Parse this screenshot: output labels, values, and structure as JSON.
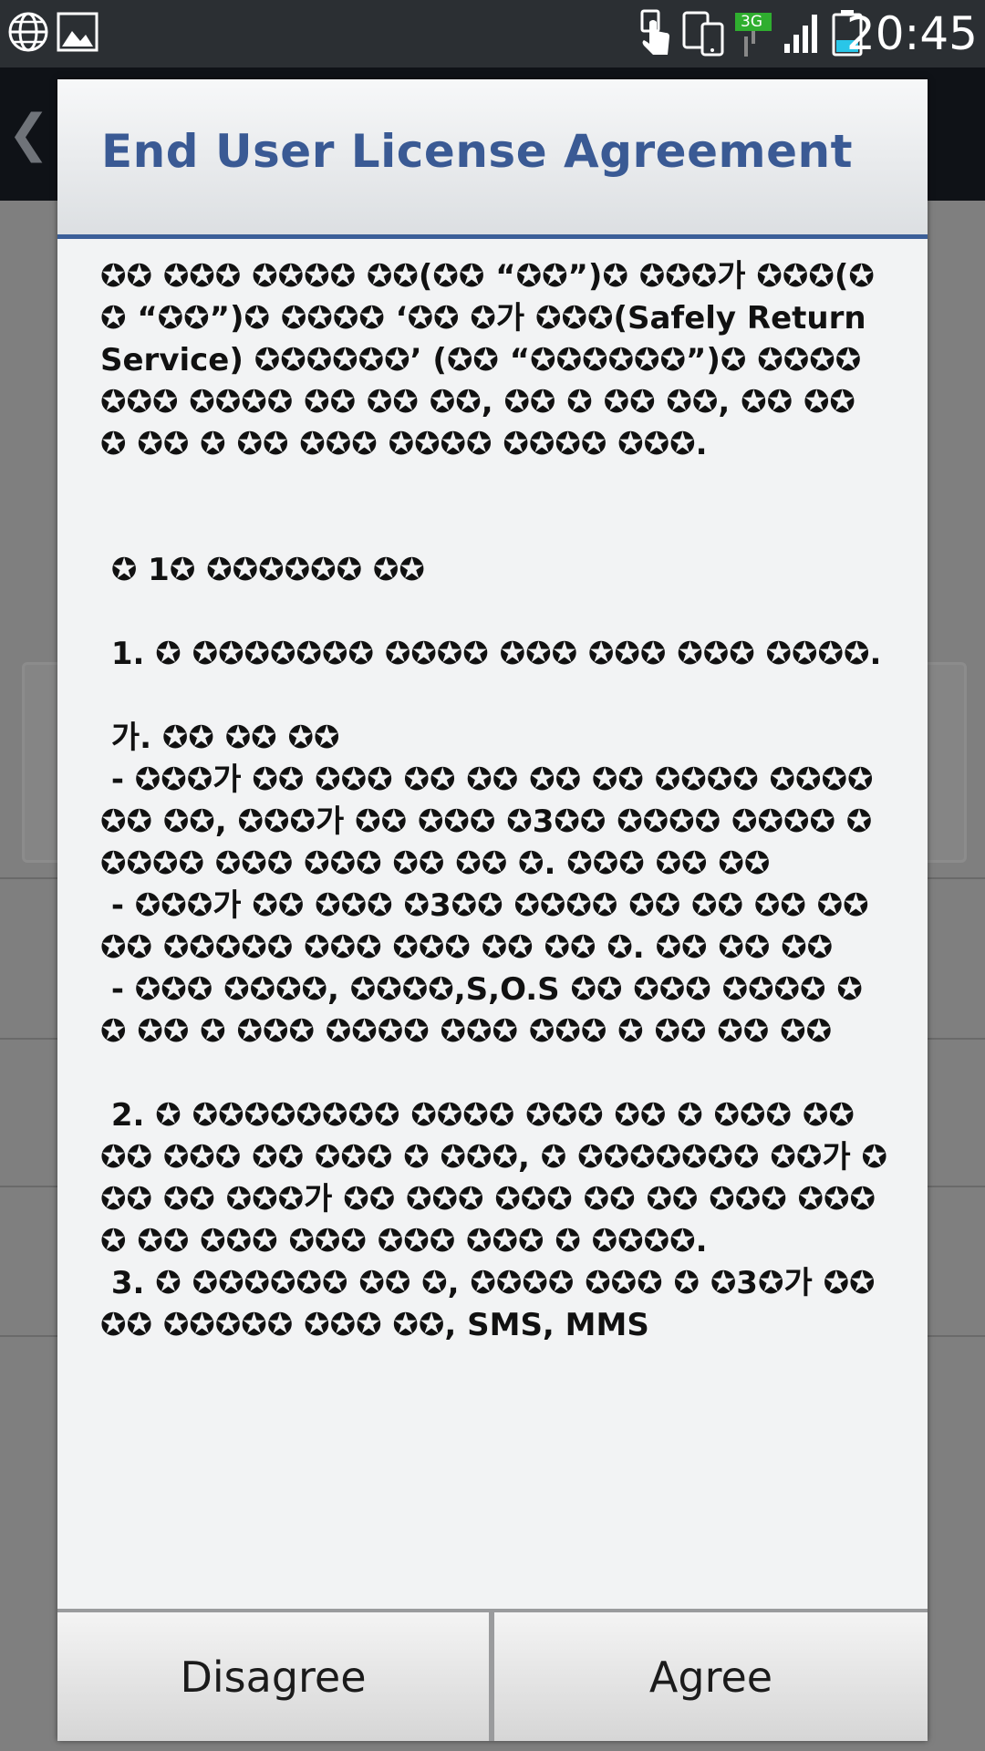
{
  "status_bar": {
    "time": "20:45",
    "network_label": "3G",
    "icons": [
      "globe-icon",
      "gallery-icon",
      "touch-icon",
      "phone-link-icon",
      "signal-icon",
      "battery-icon"
    ]
  },
  "dialog": {
    "title": "End User License Agreement",
    "body": "✪✪ ✪✪✪ ✪✪✪✪ ✪✪(✪✪ “✪✪”)✪ ✪✪✪가 ✪✪✪(✪✪ “✪✪”)✪ ✪✪✪✪ ‘✪✪ ✪가 ✪✪✪(Safely Return Service) ✪✪✪✪✪✪’ (✪✪ “✪✪✪✪✪✪”)✪ ✪✪✪✪ ✪✪✪ ✪✪✪✪ ✪✪ ✪✪ ✪✪, ✪✪ ✪ ✪✪ ✪✪, ✪✪ ✪✪ ✪ ✪✪ ✪ ✪✪ ✪✪✪ ✪✪✪✪ ✪✪✪✪ ✪✪✪.\n\n\n ✪ 1✪ ✪✪✪✪✪✪ ✪✪\n\n 1. ✪ ✪✪✪✪✪✪✪ ✪✪✪✪ ✪✪✪ ✪✪✪ ✪✪✪ ✪✪✪✪.\n\n 가. ✪✪ ✪✪ ✪✪\n - ✪✪✪가 ✪✪ ✪✪✪ ✪✪ ✪✪ ✪✪ ✪✪ ✪✪✪✪ ✪✪✪✪ ✪✪ ✪✪, ✪✪✪가 ✪✪ ✪✪✪ ✪3✪✪ ✪✪✪✪ ✪✪✪✪ ✪✪✪✪✪ ✪✪✪ ✪✪✪ ✪✪ ✪✪ ✪. ✪✪✪ ✪✪ ✪✪\n - ✪✪✪가 ✪✪ ✪✪✪ ✪3✪✪ ✪✪✪✪ ✪✪ ✪✪ ✪✪ ✪✪✪✪ ✪✪✪✪✪ ✪✪✪ ✪✪✪ ✪✪ ✪✪ ✪. ✪✪ ✪✪ ✪✪\n - ✪✪✪ ✪✪✪✪, ✪✪✪✪,S,O.S ✪✪ ✪✪✪ ✪✪✪✪ ✪✪ ✪✪ ✪ ✪✪✪ ✪✪✪✪ ✪✪✪ ✪✪✪ ✪ ✪✪ ✪✪ ✪✪\n\n 2. ✪ ✪✪✪✪✪✪✪✪ ✪✪✪✪ ✪✪✪ ✪✪ ✪ ✪✪✪ ✪✪ ✪✪ ✪✪✪ ✪✪ ✪✪✪ ✪ ✪✪✪, ✪ ✪✪✪✪✪✪✪ ✪✪가 ✪✪✪ ✪✪ ✪✪✪가 ✪✪ ✪✪✪ ✪✪✪ ✪✪ ✪✪ ✪✪✪ ✪✪✪✪ ✪✪ ✪✪✪ ✪✪✪ ✪✪✪ ✪✪✪ ✪ ✪✪✪✪.\n 3. ✪ ✪✪✪✪✪✪ ✪✪ ✪, ✪✪✪✪ ✪✪✪ ✪ ✪3✪가 ✪✪✪✪ ✪✪✪✪✪ ✪✪✪ ✪✪, SMS, MMS"
  },
  "buttons": {
    "disagree": "Disagree",
    "agree": "Agree"
  }
}
